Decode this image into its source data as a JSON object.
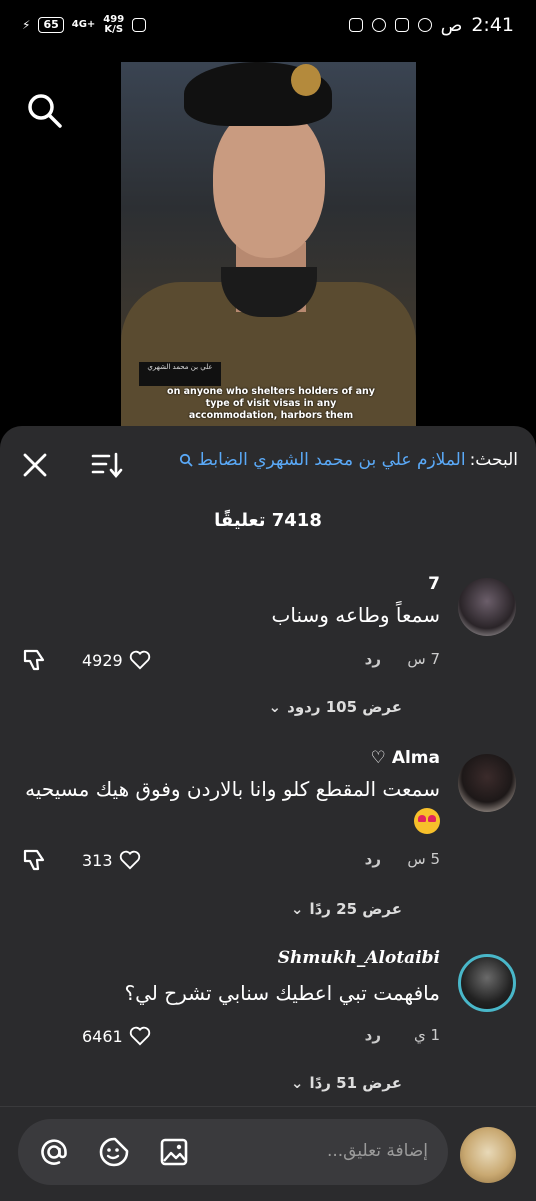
{
  "status_bar": {
    "battery": "65",
    "network": "4G+",
    "speed_top": "499",
    "speed_bottom": "K/S",
    "time": "2:41",
    "ampm": "ص"
  },
  "video": {
    "nameplate": "علي بن محمد الشهري",
    "subtitle": "on anyone who shelters holders of any type of visit visas in any accommodation, harbors them"
  },
  "search_header": {
    "label": "البحث:",
    "query": "الملازم علي بن محمد الشهري الضابط"
  },
  "comments_count": "7418 تعليقًا",
  "comments": [
    {
      "author": "7",
      "text": "سمعاً وطاعه وسناب",
      "time": "7 س",
      "reply": "رد",
      "likes": "4929",
      "replies": "عرض 105 ردود"
    },
    {
      "author": "Alma ♡",
      "text": "سمعت المقطع كلو وانا بالاردن وفوق هيك مسيحيه",
      "time": "5 س",
      "reply": "رد",
      "likes": "313",
      "replies": "عرض 25 ردًا"
    },
    {
      "author": "Shmukh_Alotaibi",
      "text": "مافهمت تبي اعطيك سنابي تشرح لي؟",
      "time": "1 ي",
      "reply": "رد",
      "likes": "6461",
      "replies": "عرض 51 ردًا"
    }
  ],
  "composer": {
    "placeholder": "إضافة تعليق..."
  },
  "colors": {
    "sheet_bg": "#2b2b2d",
    "link_blue": "#5aa9f7",
    "input_bg": "#3a3a3d"
  }
}
